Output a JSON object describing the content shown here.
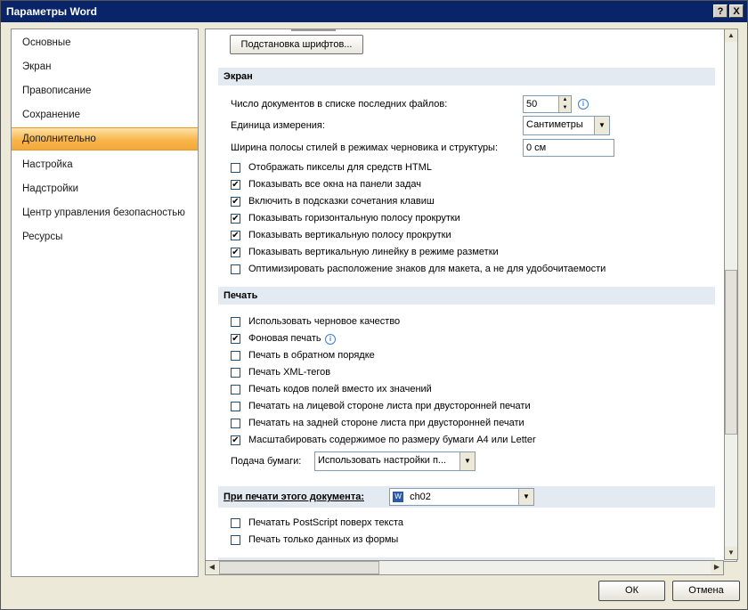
{
  "window": {
    "title": "Параметры Word",
    "help_btn": "?",
    "close_btn": "X"
  },
  "sidebar": {
    "items": [
      {
        "label": "Основные"
      },
      {
        "label": "Экран"
      },
      {
        "label": "Правописание"
      },
      {
        "label": "Сохранение"
      },
      {
        "label": "Дополнительно",
        "active": true
      },
      {
        "label": "Настройка"
      },
      {
        "label": "Надстройки"
      },
      {
        "label": "Центр управления безопасностью"
      },
      {
        "label": "Ресурсы"
      }
    ]
  },
  "content": {
    "font_subst_button": "Подстановка шрифтов...",
    "screen_section": {
      "title": "Экран",
      "recent_docs_label": "Число документов в списке последних файлов:",
      "recent_docs_value": "50",
      "units_label": "Единица измерения:",
      "units_value": "Сантиметры",
      "style_width_label": "Ширина полосы стилей в режимах черновика и структуры:",
      "style_width_value": "0 см",
      "options": [
        {
          "label": "Отображать пикселы для средств HTML",
          "checked": false
        },
        {
          "label": "Показывать все окна на панели задач",
          "checked": true
        },
        {
          "label": "Включить в подсказки сочетания клавиш",
          "checked": true
        },
        {
          "label": "Показывать горизонтальную полосу прокрутки",
          "checked": true
        },
        {
          "label": "Показывать вертикальную полосу прокрутки",
          "checked": true
        },
        {
          "label": "Показывать вертикальную линейку в режиме разметки",
          "checked": true
        },
        {
          "label": "Оптимизировать расположение знаков для макета, а не для удобочитаемости",
          "checked": false
        }
      ]
    },
    "print_section": {
      "title": "Печать",
      "options": [
        {
          "label": "Использовать черновое качество",
          "checked": false
        },
        {
          "label": "Фоновая печать",
          "checked": true
        },
        {
          "label": "Печать в обратном порядке",
          "checked": false
        },
        {
          "label": "Печать XML-тегов",
          "checked": false
        },
        {
          "label": "Печать кодов полей вместо их значений",
          "checked": false
        },
        {
          "label": "Печатать на лицевой стороне листа при двусторонней печати",
          "checked": false
        },
        {
          "label": "Печатать на задней стороне листа при двусторонней печати",
          "checked": false
        },
        {
          "label": "Масштабировать содержимое по размеру бумаги A4 или Letter",
          "checked": true
        }
      ],
      "paper_feed_label": "Подача бумаги:",
      "paper_feed_value": "Использовать настройки п..."
    },
    "doc_print_section": {
      "title": "При печати этого документа:",
      "doc_value": "ch02",
      "options": [
        {
          "label": "Печатать PostScript поверх текста",
          "checked": false
        },
        {
          "label": "Печать только данных из формы",
          "checked": false
        }
      ]
    }
  },
  "footer": {
    "ok": "ОК",
    "cancel": "Отмена"
  }
}
